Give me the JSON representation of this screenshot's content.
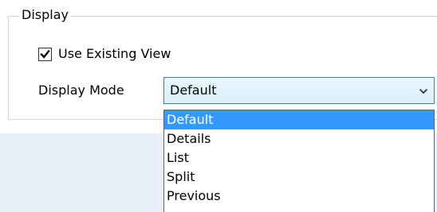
{
  "display_group": {
    "title": "Display",
    "use_existing_view": {
      "label": "Use Existing View",
      "checked": true
    },
    "display_mode": {
      "label": "Display Mode",
      "selected": "Default",
      "options": [
        "Default",
        "Details",
        "List",
        "Split",
        "Previous"
      ],
      "highlighted_option": "Default"
    }
  },
  "colors": {
    "selection_highlight": "#3399ff",
    "lower_panel_background": "#e9eff9",
    "combo_border": "#3c7fb1"
  },
  "icons": {
    "checkbox": "checkmark-icon",
    "dropdown": "chevron-down-icon"
  }
}
